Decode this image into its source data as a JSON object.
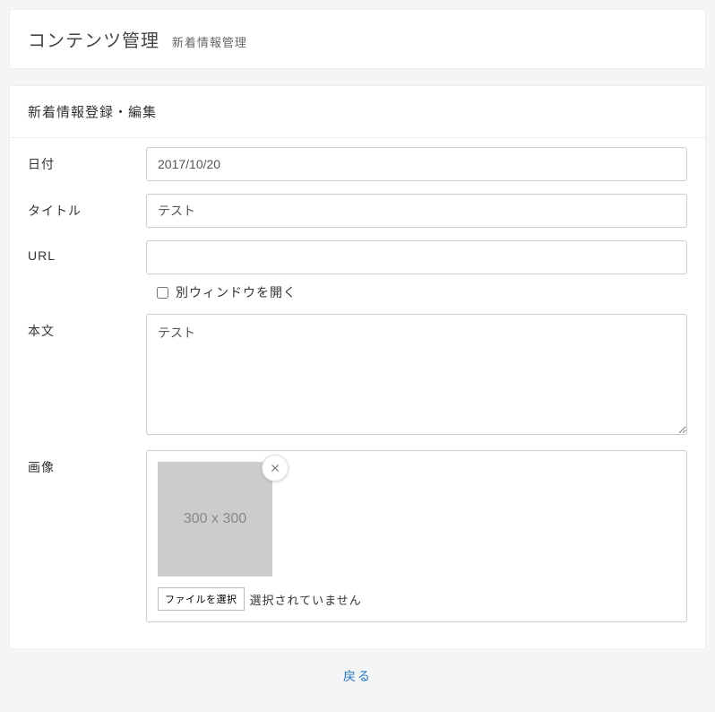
{
  "header": {
    "title": "コンテンツ管理",
    "subtitle": "新着情報管理"
  },
  "panel": {
    "title": "新着情報登録・編集"
  },
  "form": {
    "date": {
      "label": "日付",
      "value": "2017/10/20"
    },
    "title_field": {
      "label": "タイトル",
      "value": "テスト"
    },
    "url": {
      "label": "URL",
      "value": "",
      "new_window_label": "別ウィンドウを開く",
      "new_window_checked": false
    },
    "body": {
      "label": "本文",
      "value": "テスト"
    },
    "image": {
      "label": "画像",
      "placeholder_text": "300 x 300",
      "file_button": "ファイルを選択",
      "file_status": "選択されていません"
    }
  },
  "footer": {
    "back_label": "戻る"
  }
}
